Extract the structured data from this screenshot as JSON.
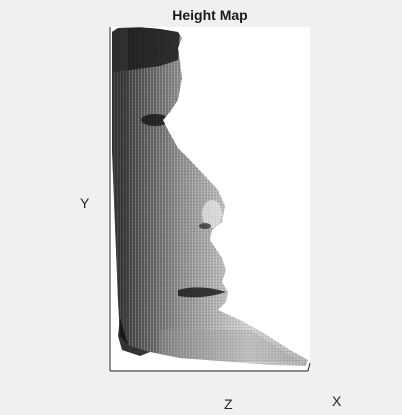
{
  "window": {
    "background": "#f0f0f0"
  },
  "chart_data": {
    "type": "surface",
    "title": "Height Map",
    "axis_labels": {
      "x": "X",
      "y": "Y",
      "z": "Z"
    },
    "view": "side",
    "colormap": "gray",
    "grid": false,
    "legend": "none",
    "colorbar": false
  }
}
